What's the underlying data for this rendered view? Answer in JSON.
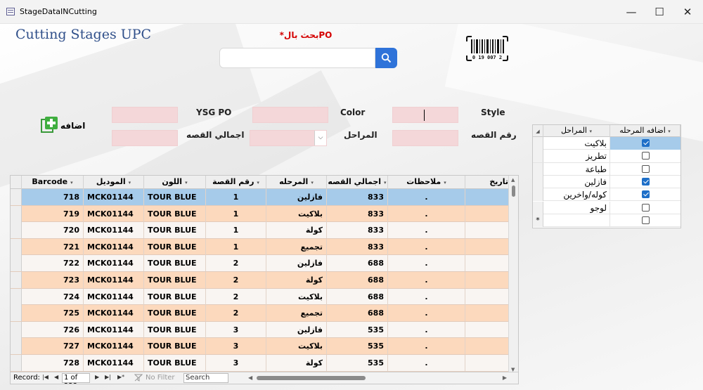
{
  "window": {
    "title": "StageDataINCutting",
    "minimize_glyph": "—",
    "maximize_glyph": "☐",
    "close_glyph": "✕"
  },
  "header": {
    "brand": "Cutting Stages UPC",
    "search_hint": "*بحث بالPO",
    "search_value": ""
  },
  "barcode": {
    "digits": "0 19 007 2"
  },
  "form": {
    "style_label": "Style",
    "color_label": "Color",
    "ysgpo_label": "YSG PO",
    "cut_number_label": "رقم القصه",
    "stages_label": "المراحل",
    "total_cut_label": "اجمالي القصه",
    "add_label": "اضافه",
    "combo_arrow": "⌵"
  },
  "grid": {
    "headers": {
      "barcode": "Barcode",
      "model": "الموديل",
      "color": "اللون",
      "cut_number": "رقم القصة",
      "stage": "المرحله",
      "total": "اجمالي القصه",
      "notes": "ملاحظات",
      "date": "تاريخ"
    },
    "rows": [
      {
        "barcode": "718",
        "model": "MCK01144",
        "color": "TOUR BLUE",
        "cut": "1",
        "stage": "فازلين",
        "total": "833",
        "notes": "."
      },
      {
        "barcode": "719",
        "model": "MCK01144",
        "color": "TOUR BLUE",
        "cut": "1",
        "stage": "بلاكيت",
        "total": "833",
        "notes": "."
      },
      {
        "barcode": "720",
        "model": "MCK01144",
        "color": "TOUR BLUE",
        "cut": "1",
        "stage": "كولة",
        "total": "833",
        "notes": "."
      },
      {
        "barcode": "721",
        "model": "MCK01144",
        "color": "TOUR BLUE",
        "cut": "1",
        "stage": "تجميع",
        "total": "833",
        "notes": "."
      },
      {
        "barcode": "722",
        "model": "MCK01144",
        "color": "TOUR BLUE",
        "cut": "2",
        "stage": "فازلين",
        "total": "688",
        "notes": "."
      },
      {
        "barcode": "723",
        "model": "MCK01144",
        "color": "TOUR BLUE",
        "cut": "2",
        "stage": "كولة",
        "total": "688",
        "notes": "."
      },
      {
        "barcode": "724",
        "model": "MCK01144",
        "color": "TOUR BLUE",
        "cut": "2",
        "stage": "بلاكيت",
        "total": "688",
        "notes": "."
      },
      {
        "barcode": "725",
        "model": "MCK01144",
        "color": "TOUR BLUE",
        "cut": "2",
        "stage": "تجميع",
        "total": "688",
        "notes": "."
      },
      {
        "barcode": "726",
        "model": "MCK01144",
        "color": "TOUR BLUE",
        "cut": "3",
        "stage": "فازلين",
        "total": "535",
        "notes": "."
      },
      {
        "barcode": "727",
        "model": "MCK01144",
        "color": "TOUR BLUE",
        "cut": "3",
        "stage": "بلاكيت",
        "total": "535",
        "notes": "."
      },
      {
        "barcode": "728",
        "model": "MCK01144",
        "color": "TOUR BLUE",
        "cut": "3",
        "stage": "كولة",
        "total": "535",
        "notes": "."
      }
    ],
    "nav": {
      "record_label": "Record:",
      "record_value": "1 of 223",
      "no_filter": "No Filter",
      "search": "Search"
    }
  },
  "stages": {
    "headers": {
      "name": "المراحل",
      "add": "اضافه المرحله"
    },
    "rows": [
      {
        "name": "بلاكيت",
        "checked": true
      },
      {
        "name": "تطريز",
        "checked": false
      },
      {
        "name": "طباعة",
        "checked": false
      },
      {
        "name": "فازلين",
        "checked": true
      },
      {
        "name": "كوله/واخرين",
        "checked": true
      },
      {
        "name": "لوجو",
        "checked": false
      },
      {
        "name": "",
        "checked": false
      }
    ],
    "new_row_marker": "*"
  },
  "colors": {
    "accent": "#2f73d9",
    "brand": "#2f4f8a",
    "hint": "#d40000",
    "field_bg": "#f4d7d9",
    "row_alt": "#fcd9bd",
    "row_selected": "#a6cbea"
  }
}
